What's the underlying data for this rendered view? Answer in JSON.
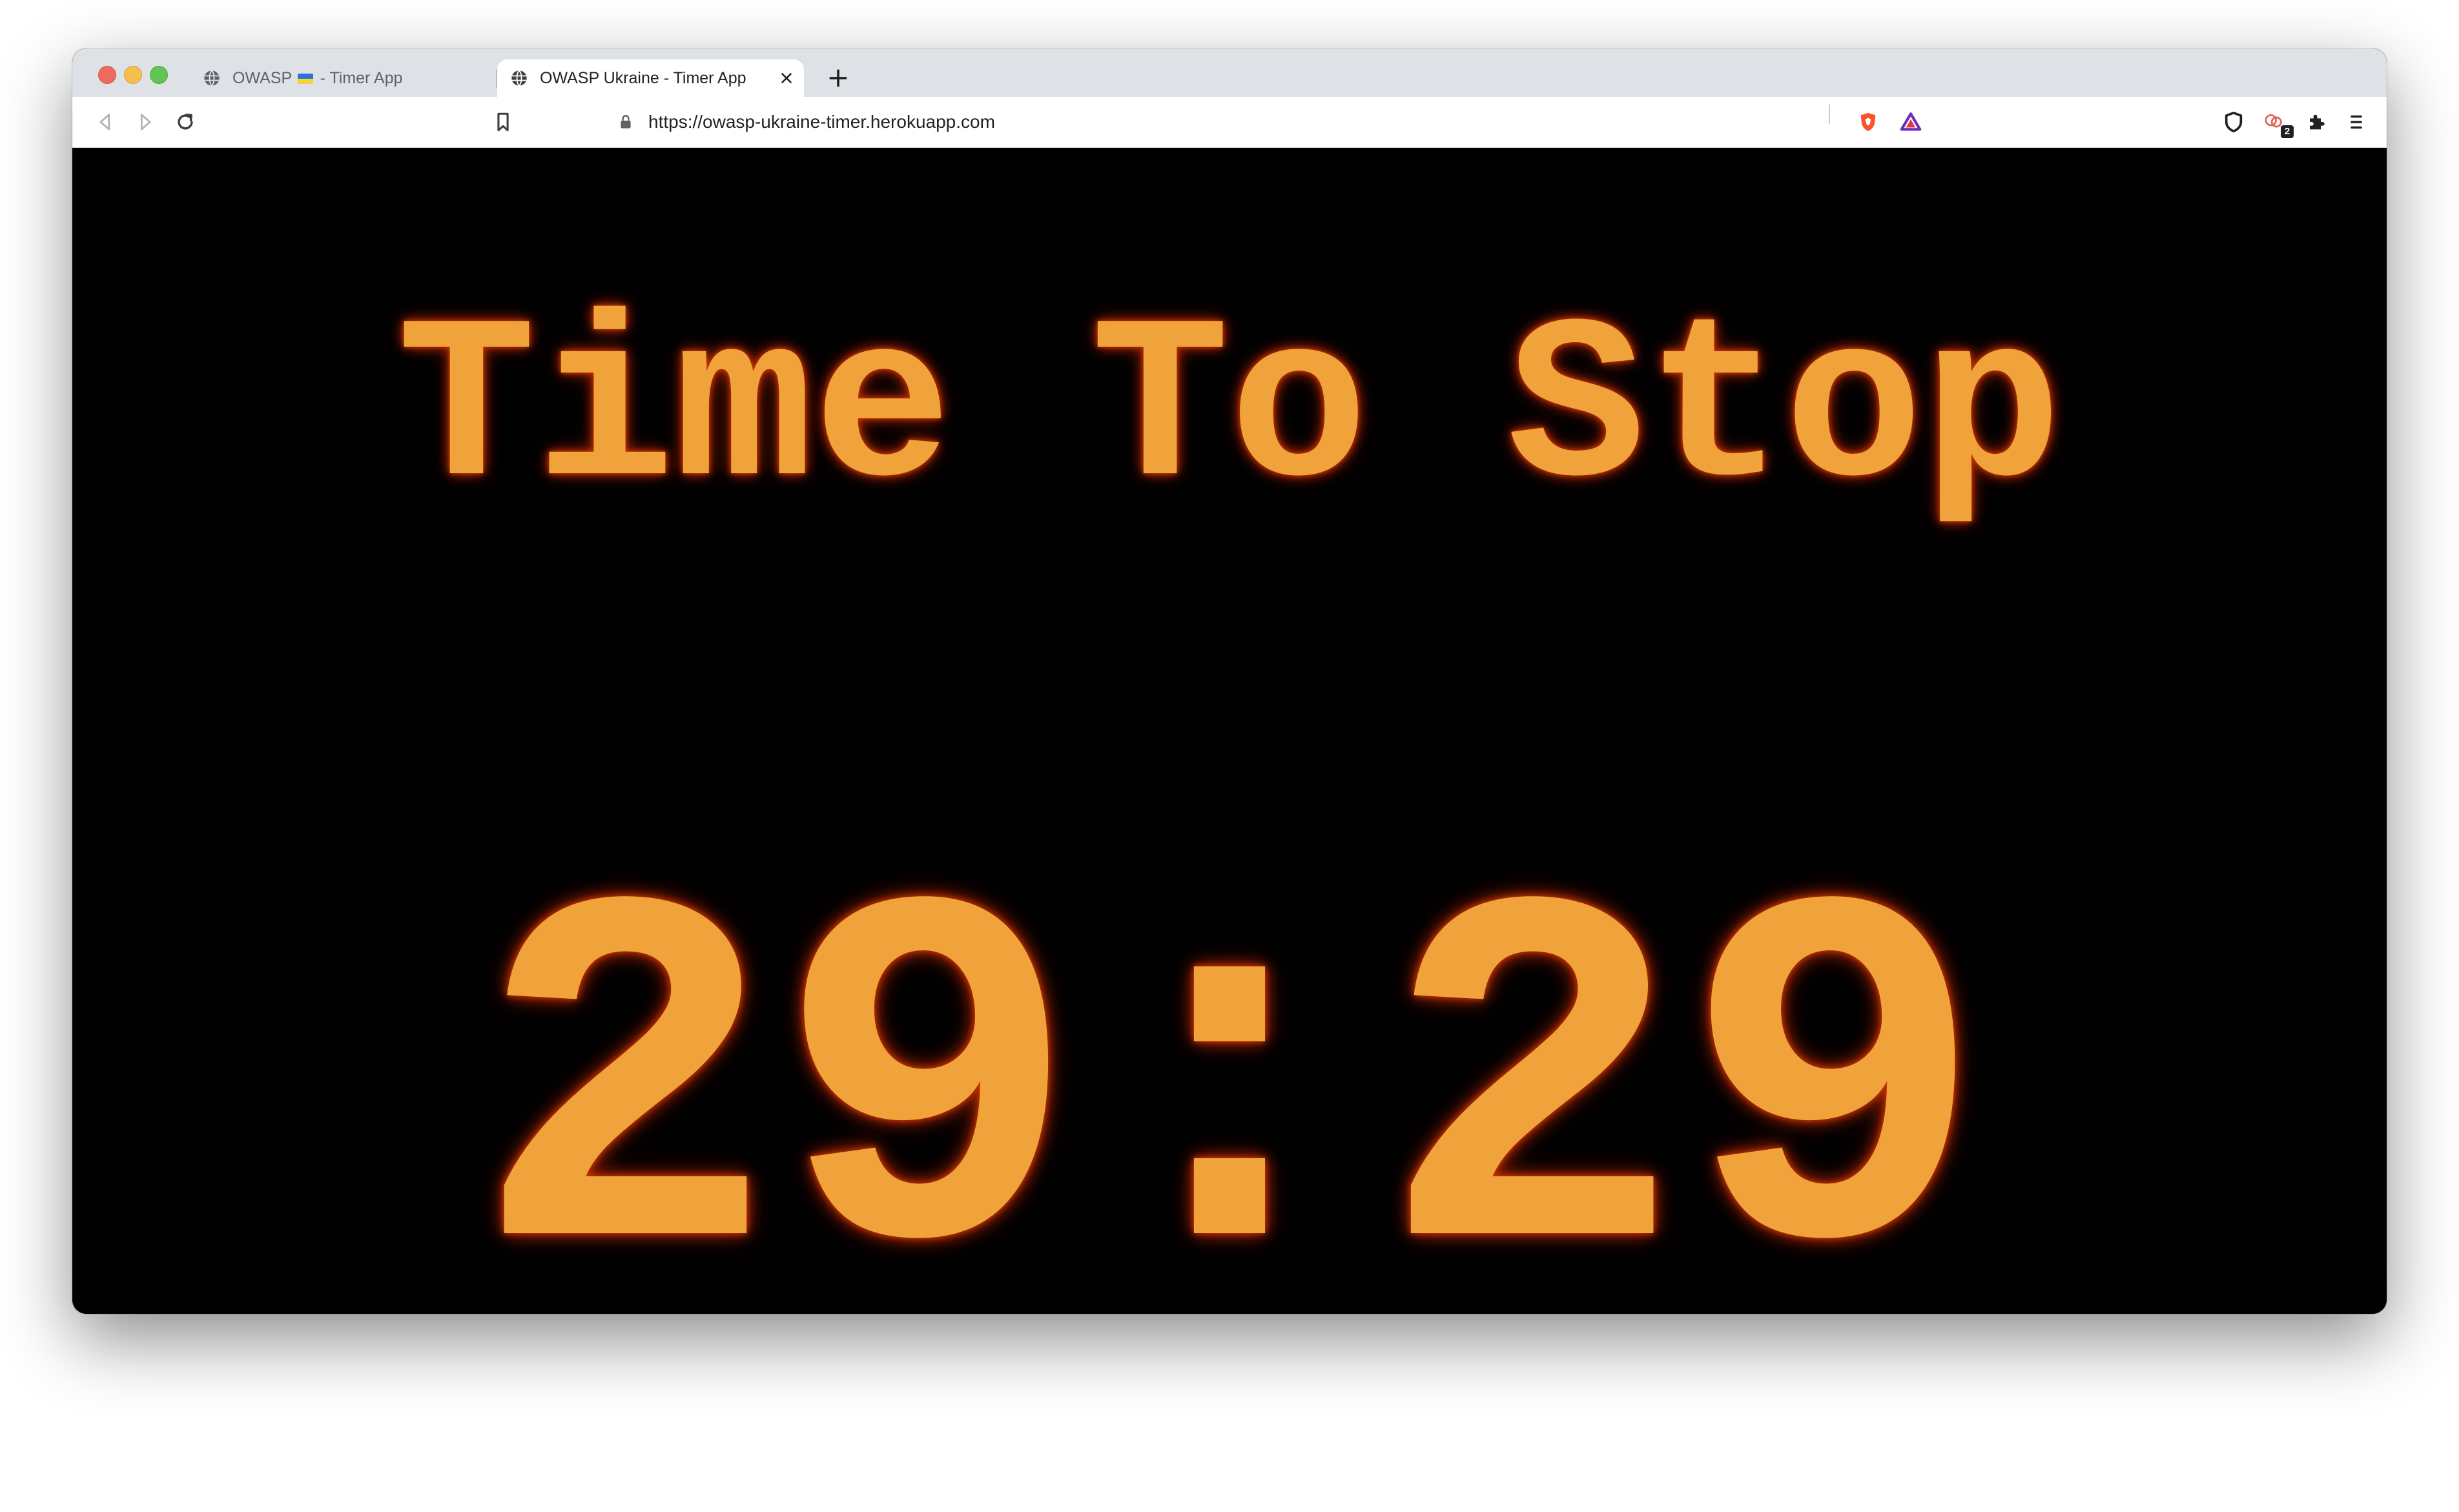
{
  "browser": {
    "tabs": [
      {
        "label_prefix": "OWASP",
        "label_suffix": " - Timer App",
        "has_flag": true,
        "icon": "globe-icon",
        "active": false
      },
      {
        "label": "OWASP Ukraine - Timer App",
        "icon": "globe-icon",
        "active": true
      }
    ],
    "address_bar": {
      "url": "https://owasp-ukraine-timer.herokuapp.com"
    },
    "extension_badge": "2",
    "colors": {
      "tabstrip": "#dee1e6",
      "close": "#ed6a5e",
      "minimize": "#f5bf4f",
      "maximize": "#61c554",
      "brave_orange": "#fb542b"
    }
  },
  "page": {
    "heading": "Time To Stop",
    "timer": "29:29",
    "colors": {
      "background": "#000000",
      "text": "#f0a33a",
      "glow": "#d23a00"
    }
  }
}
